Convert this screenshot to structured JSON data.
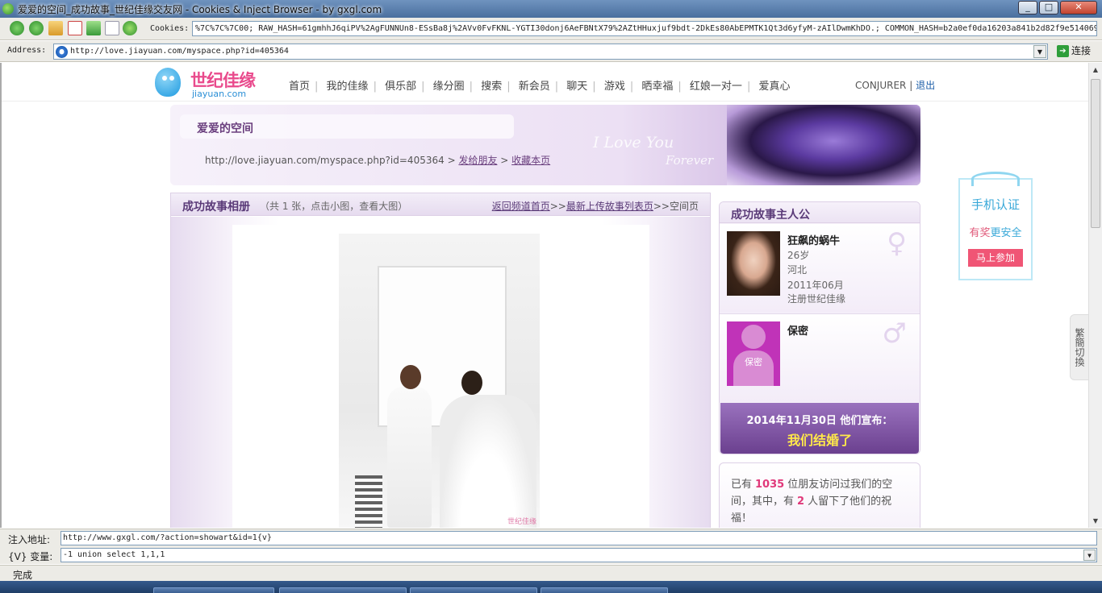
{
  "window": {
    "title": "爱爱的空间_成功故事_世纪佳缘交友网 - Cookies & Inject Browser - by gxgl.com",
    "min": "_",
    "max": "□",
    "close": "✕"
  },
  "toolbar": {
    "cookies_label": "Cookies:",
    "cookies_value": "%7C%7C%7C00; RAW_HASH=61gmhhJ6qiPV%2AgFUNNUn8-ESsBa8j%2AVv0FvFKNL-YGTI30donj6AeFBNtX79%2AZtHHuxjuf9bdt-2DkEs80AbEPMTK1Qt3d6yfyM-zAIlDwmKhDO.; COMMON_HASH=b2a0ef0da16203a841b2d82f9e514069"
  },
  "address": {
    "label": "Address:",
    "value": "http://love.jiayuan.com/myspace.php?id=405364",
    "go_label": "连接"
  },
  "site": {
    "logo_cn": "世纪佳缘",
    "logo_en": "jiayuan.com",
    "nav": [
      "首页",
      "我的佳缘",
      "俱乐部",
      "缘分圈",
      "搜索",
      "新会员",
      "聊天",
      "游戏",
      "晒幸福",
      "红娘一对一",
      "爱真心"
    ],
    "username": "CONJURER",
    "user_sep": "|",
    "logout": "退出"
  },
  "banner": {
    "title": "爱爱的空间",
    "url": "http://love.jiayuan.com/myspace.php?id=405364",
    "sep1": " > ",
    "send_friend": "发给朋友",
    "sep2": " > ",
    "bookmark": "收藏本页",
    "love": "I Love You",
    "forever": "Forever"
  },
  "album": {
    "title": "成功故事相册",
    "subtitle": "（共 1 张，点击小图，查看大图）",
    "link_home": "返回频道首页",
    "sep1": ">>",
    "link_list": "最新上传故事列表页",
    "sep2": ">>",
    "current": "空间页",
    "photo_mark": "世纪佳缘"
  },
  "couple": {
    "title": "成功故事主人公",
    "person1": {
      "name": "狂飙的蜗牛",
      "age": "26岁",
      "region": "河北",
      "date": "2011年06月",
      "note": "注册世纪佳缘",
      "symbol": "♀"
    },
    "person2": {
      "name": "保密",
      "avatar_text": "保密",
      "symbol": "♂"
    },
    "announce_date": "2014年11月30日  他们宣布：",
    "announce_main": "我们结婚了"
  },
  "visits": {
    "pre": "已有",
    "count": "1035",
    "mid": "位朋友访问过我们的空间，其中，有",
    "blessings": "2",
    "post": "人留下了他们的祝福！"
  },
  "phone_ad": {
    "title": "手机认证",
    "sub_a": "有奖",
    "sub_b": "更安全",
    "button": "马上参加"
  },
  "trad_toggle": "繁簡切換",
  "inject": {
    "label": "注入地址:",
    "value": "http://www.gxgl.com/?action=showart&id=1{v}"
  },
  "variable": {
    "label": "{V} 变量:",
    "value": "-1 union select 1,1,1"
  },
  "status": "完成"
}
